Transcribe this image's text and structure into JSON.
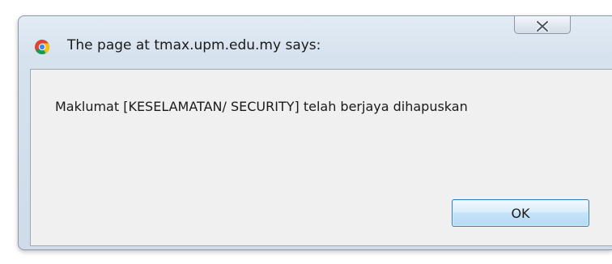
{
  "dialog": {
    "title": "The page at tmax.upm.edu.my says:",
    "icon": "chrome-icon",
    "close_icon": "close-icon",
    "message": "Maklumat [KESELAMATAN/ SECURITY] telah berjaya dihapuskan",
    "ok_label": "OK"
  },
  "colors": {
    "frame": "#d6e2ee",
    "client_background": "#f0f0f0",
    "ok_border": "#3c7fb1"
  }
}
